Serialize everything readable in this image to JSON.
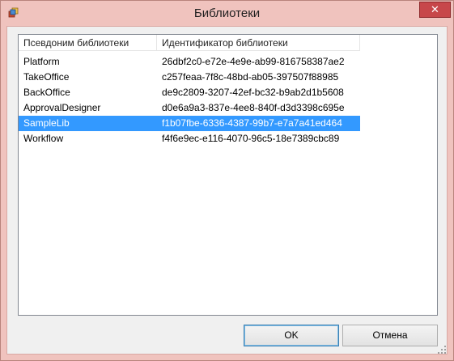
{
  "window": {
    "title": "Библиотеки",
    "close_glyph": "✕"
  },
  "list": {
    "columns": [
      "Псевдоним библиотеки",
      "Идентификатор библиотеки"
    ],
    "rows": [
      {
        "alias": "Platform",
        "id": "26dbf2c0-e72e-4e9e-ab99-816758387ae2",
        "selected": false
      },
      {
        "alias": "TakeOffice",
        "id": "c257feaa-7f8c-48bd-ab05-397507f88985",
        "selected": false
      },
      {
        "alias": "BackOffice",
        "id": "de9c2809-3207-42ef-bc32-b9ab2d1b5608",
        "selected": false
      },
      {
        "alias": "ApprovalDesigner",
        "id": "d0e6a9a3-837e-4ee8-840f-d3d3398c695e",
        "selected": false
      },
      {
        "alias": "SampleLib",
        "id": "f1b07fbe-6336-4387-99b7-e7a7a41ed464",
        "selected": true
      },
      {
        "alias": "Workflow",
        "id": "f4f6e9ec-e116-4070-96c5-18e7389cbc89",
        "selected": false
      }
    ]
  },
  "buttons": {
    "ok_label": "OK",
    "cancel_label": "Отмена"
  },
  "colors": {
    "selection": "#3399ff",
    "titlebar": "#f0c3be",
    "close_button": "#c7474a"
  }
}
